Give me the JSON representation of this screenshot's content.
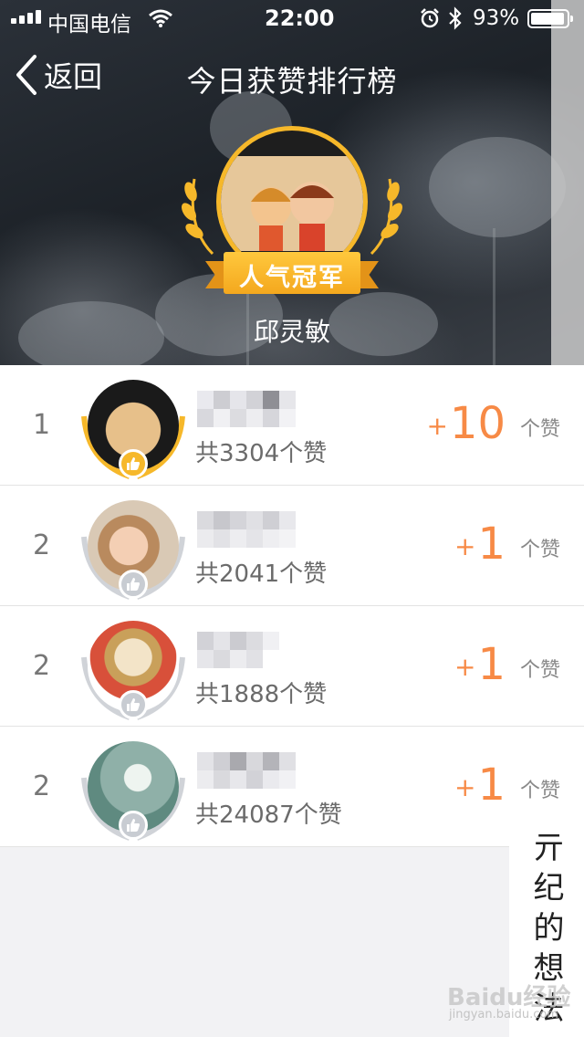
{
  "status_bar": {
    "carrier": "中国电信",
    "time": "22:00",
    "battery": "93%"
  },
  "nav": {
    "back_label": "返回",
    "title": "今日获赞排行榜"
  },
  "champion": {
    "badge": "人气冠军",
    "name": "邱灵敏"
  },
  "list": [
    {
      "rank": "1",
      "total": "共3304个赞",
      "gain": "10",
      "plus": "+",
      "unit": "个赞",
      "badge": "gold"
    },
    {
      "rank": "2",
      "total": "共2041个赞",
      "gain": "1",
      "plus": "+",
      "unit": "个赞",
      "badge": "silver"
    },
    {
      "rank": "2",
      "total": "共1888个赞",
      "gain": "1",
      "plus": "+",
      "unit": "个赞",
      "badge": "silver"
    },
    {
      "rank": "2",
      "total": "共24087个赞",
      "gain": "1",
      "plus": "+",
      "unit": "个赞",
      "badge": "silver"
    }
  ],
  "watermark": {
    "text": "亓纪的想法",
    "brand": "Baidu经验",
    "site": "jingyan.baidu.com"
  },
  "colors": {
    "accent_orange": "#f78a46",
    "gold": "#f6b82a",
    "silver": "#c8ccd2"
  }
}
